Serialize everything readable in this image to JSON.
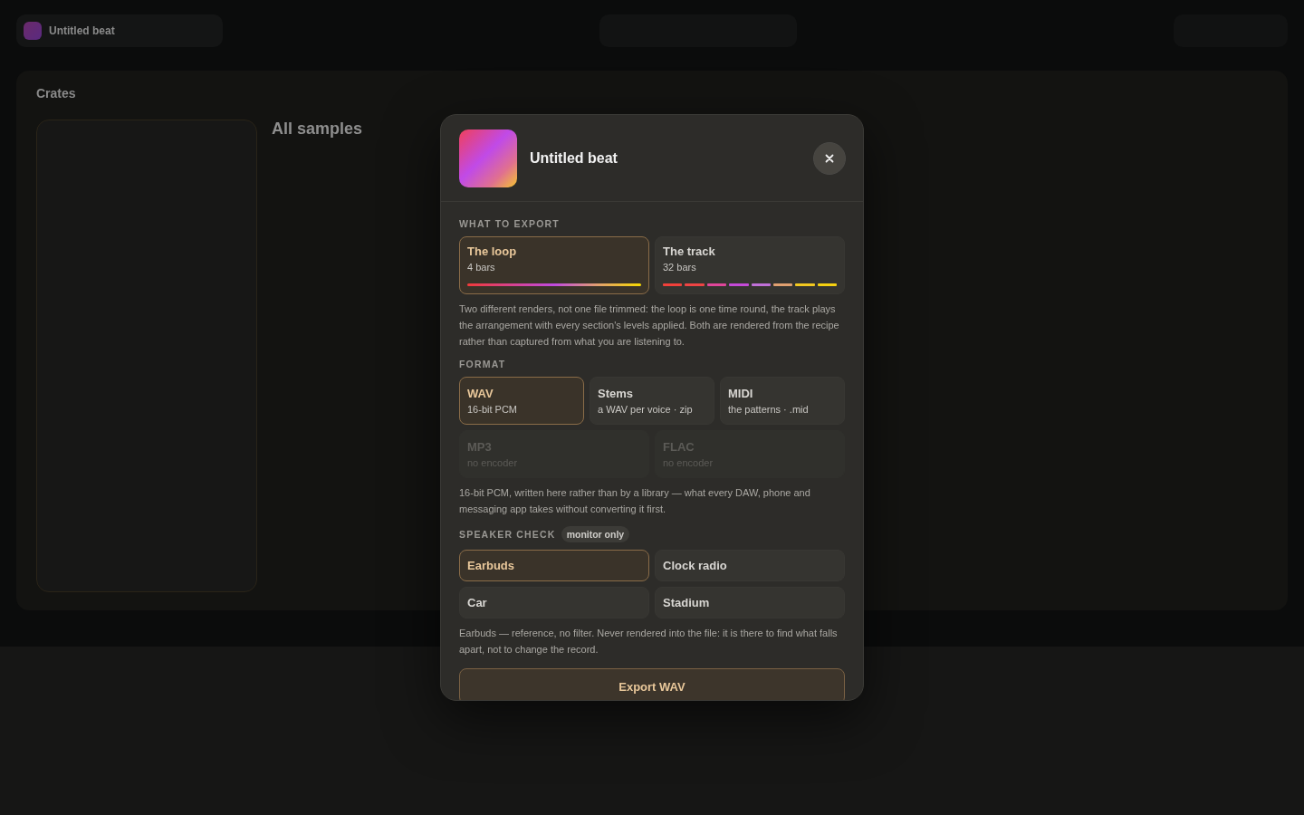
{
  "background": {
    "project_title": "Untitled beat",
    "section_title": "Crates",
    "panel_heading": "All samples"
  },
  "dialog": {
    "title": "Untitled beat",
    "export_section": {
      "label": "WHAT TO EXPORT",
      "options": [
        {
          "title": "The loop",
          "subtitle": "4 bars",
          "selected": true,
          "kind": "loop"
        },
        {
          "title": "The track",
          "subtitle": "32 bars",
          "selected": false,
          "kind": "track",
          "segments": [
            {
              "color": "#f0403a"
            },
            {
              "color": "#ee4444"
            },
            {
              "color": "#e0469a"
            },
            {
              "color": "#c44ad8"
            },
            {
              "color": "#c070d8"
            },
            {
              "color": "#e0a070"
            },
            {
              "color": "#f2c820"
            },
            {
              "color": "#f5d010"
            }
          ]
        }
      ],
      "note": "Two different renders, not one file trimmed: the loop is one time round, the track plays the arrangement with every section's levels applied. Both are rendered from the recipe rather than captured from what you are listening to."
    },
    "format_section": {
      "label": "FORMAT",
      "options": [
        {
          "title": "WAV",
          "subtitle": "16-bit PCM",
          "selected": true,
          "disabled": false
        },
        {
          "title": "Stems",
          "subtitle": "a WAV per voice · zip",
          "selected": false,
          "disabled": false
        },
        {
          "title": "MIDI",
          "subtitle": "the patterns · .mid",
          "selected": false,
          "disabled": false
        },
        {
          "title": "MP3",
          "subtitle": "no encoder",
          "selected": false,
          "disabled": true
        },
        {
          "title": "FLAC",
          "subtitle": "no encoder",
          "selected": false,
          "disabled": true
        }
      ],
      "note": "16-bit PCM, written here rather than by a library — what every DAW, phone and messaging app takes without converting it first."
    },
    "speaker_section": {
      "label": "SPEAKER CHECK",
      "badge": "monitor only",
      "options": [
        {
          "title": "Earbuds",
          "selected": true
        },
        {
          "title": "Clock radio",
          "selected": false
        },
        {
          "title": "Car",
          "selected": false
        },
        {
          "title": "Stadium",
          "selected": false
        }
      ],
      "note": "Earbuds — reference, no filter. Never rendered into the file: it is there to find what falls apart, not to change the record."
    },
    "export_button": "Export WAV"
  }
}
